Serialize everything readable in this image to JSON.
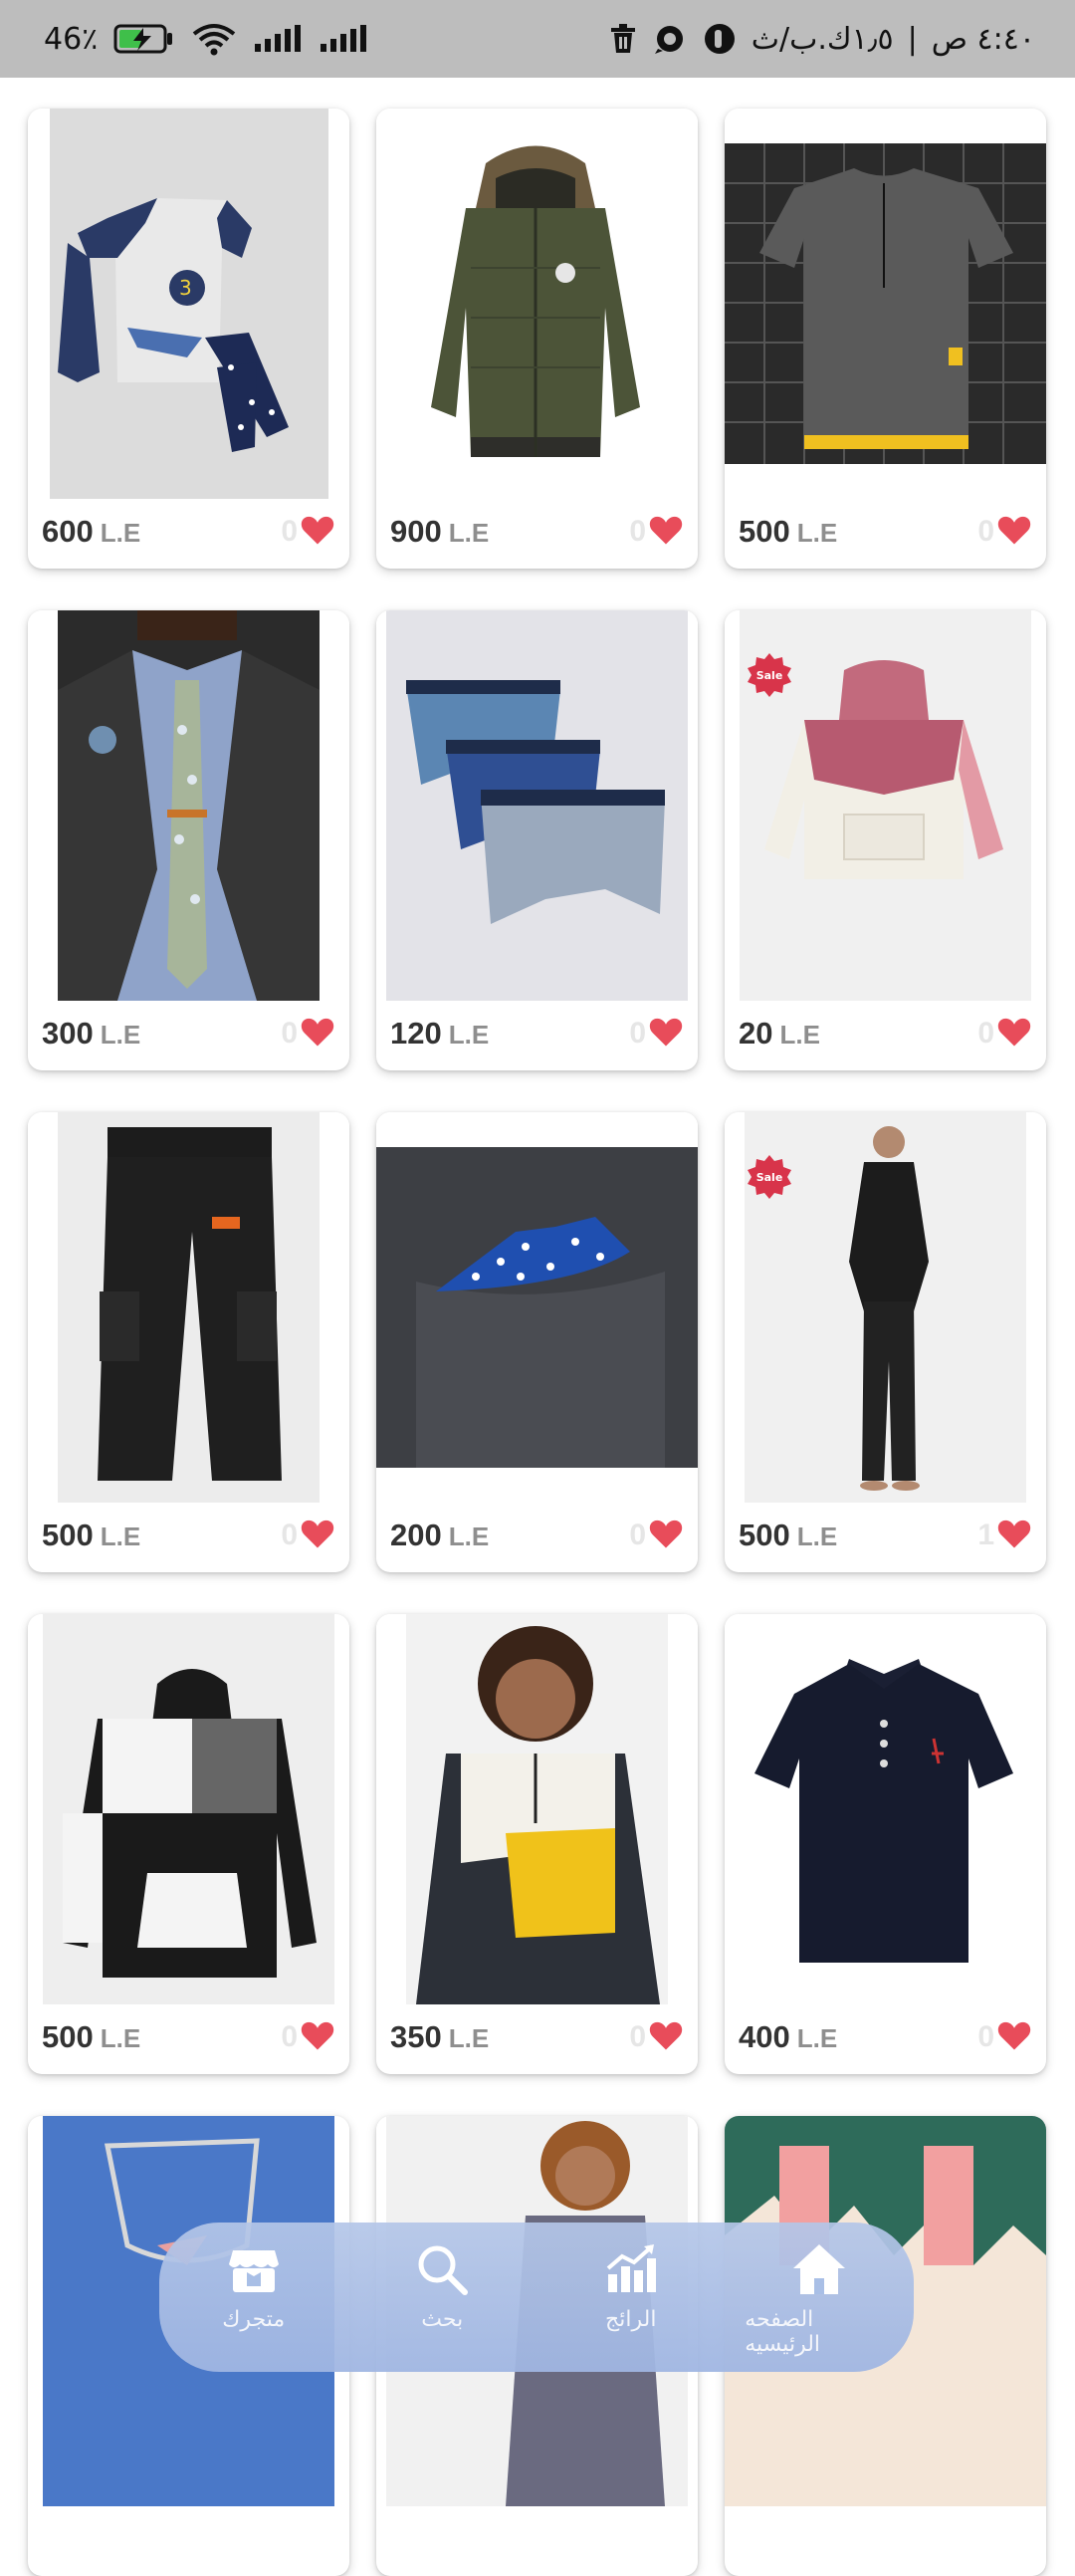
{
  "status_bar": {
    "battery_percent": "46٪",
    "time": "٤:٤٠ ص",
    "data_rate": "١٫٥ك.ب/ث"
  },
  "currency": "L.E",
  "products": [
    {
      "price": "600",
      "likes": "0",
      "sale": false,
      "image": "kids-pajama-set"
    },
    {
      "price": "900",
      "likes": "0",
      "sale": false,
      "image": "olive-puffer-jacket"
    },
    {
      "price": "500",
      "likes": "0",
      "sale": false,
      "image": "grey-tshirt"
    },
    {
      "price": "300",
      "likes": "0",
      "sale": false,
      "image": "suit-tie"
    },
    {
      "price": "120",
      "likes": "0",
      "sale": false,
      "image": "boxer-briefs"
    },
    {
      "price": "20",
      "likes": "0",
      "sale": true,
      "sale_label": "Sale",
      "image": "kids-hoodie-pink"
    },
    {
      "price": "500",
      "likes": "0",
      "sale": false,
      "image": "black-cargo-pants"
    },
    {
      "price": "200",
      "likes": "0",
      "sale": false,
      "image": "pocket-square"
    },
    {
      "price": "500",
      "likes": "1",
      "sale": true,
      "sale_label": "Sale",
      "image": "black-pajama-man"
    },
    {
      "price": "500",
      "likes": "0",
      "sale": false,
      "image": "colorblock-hoodie"
    },
    {
      "price": "350",
      "likes": "0",
      "sale": false,
      "image": "kid-colorblock-sweatshirt"
    },
    {
      "price": "400",
      "likes": "0",
      "sale": false,
      "image": "navy-polo"
    },
    {
      "image": "necklace"
    },
    {
      "image": "kid-shirt"
    },
    {
      "image": "socks"
    }
  ],
  "nav": [
    {
      "label": "متجرك",
      "icon": "store-icon"
    },
    {
      "label": "بحث",
      "icon": "search-icon"
    },
    {
      "label": "الرائج",
      "icon": "trending-icon"
    },
    {
      "label": "الصفحه الرئيسيه",
      "icon": "home-icon"
    }
  ],
  "colors": {
    "heart": "#e84c5a",
    "nav_bg": "#a9bfe6",
    "status_bg": "#bdbdbd"
  }
}
